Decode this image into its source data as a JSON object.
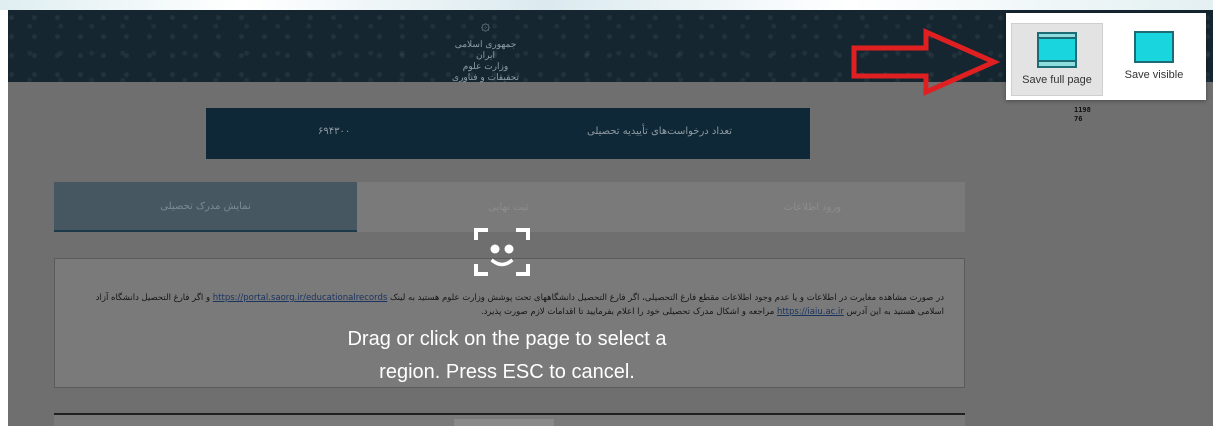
{
  "header": {
    "emblem": "۞",
    "logo_line1": "جمهوری اسلامی ایران",
    "logo_line2": "وزارت علوم تحقیقات و فناوری"
  },
  "side_numbers": [
    "1198",
    "76"
  ],
  "stat_card": {
    "label": "تعداد درخواست‌های تأییدیه تحصیلی",
    "value": "۶۹۴۳۰۰"
  },
  "tabs": [
    {
      "label": "ورود اطلاعات",
      "active": false
    },
    {
      "label": "ثبت نهایی",
      "active": false
    },
    {
      "label": "نمایش مدرک تحصیلی",
      "active": true
    }
  ],
  "notice": {
    "text": "در صورت مشاهده مغایرت در اطلاعات و یا عدم وجود اطلاعات مقطع فارغ التحصیلی، اگر فارغ التحصیل دانشگاههای تحت پوشش وزارت علوم هستید به لینک",
    "link1": "https://portal.saorg.ir/educationalrecords",
    "text2": "و اگر فارغ التحصیل دانشگاه آزاد اسلامی هستید به این آدرس",
    "link2": "https://iaiu.ac.ir",
    "text3": "مراجعه و اشکال مدرک تحصیلی خود را اعلام بفرمایید تا اقدامات لازم صورت پذیرد."
  },
  "capture_overlay": {
    "line1": "Drag or click on the page to select a",
    "line2": "region. Press ESC to cancel."
  },
  "popup": {
    "full_label": "Save full page",
    "visible_label": "Save visible"
  },
  "colors": {
    "header_bg": "#152630",
    "overlay_dim": "#6f6f6f",
    "arrow": "#e02020",
    "icon_fill": "#19d6de"
  }
}
